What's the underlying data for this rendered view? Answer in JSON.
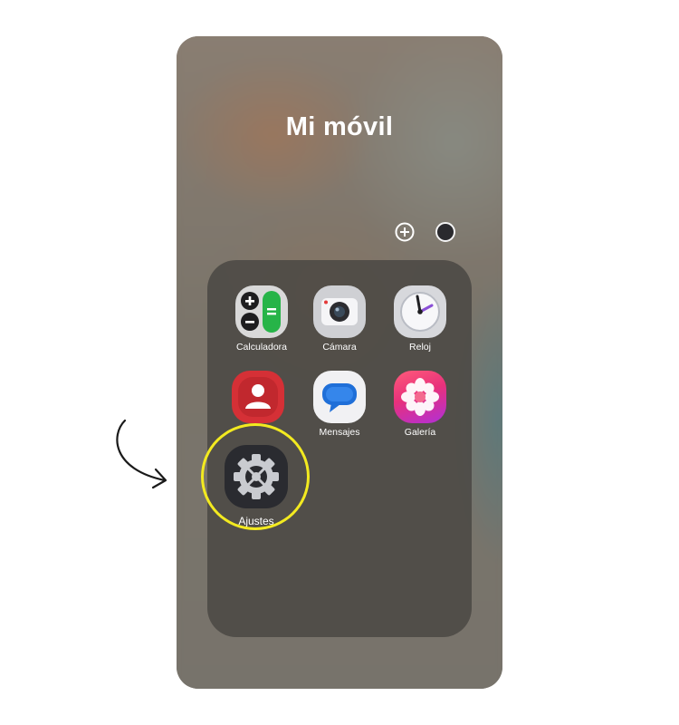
{
  "folder": {
    "title": "Mi móvil",
    "actions": {
      "add": "plus-icon",
      "color": "color-dot"
    }
  },
  "apps": [
    {
      "label": "Calculadora",
      "icon": "calculator-icon"
    },
    {
      "label": "Cámara",
      "icon": "camera-icon"
    },
    {
      "label": "Reloj",
      "icon": "clock-icon"
    },
    {
      "label": "",
      "icon": "contacts-icon"
    },
    {
      "label": "Mensajes",
      "icon": "messages-icon"
    },
    {
      "label": "Galería",
      "icon": "gallery-icon"
    },
    {
      "label": "Ajustes",
      "icon": "settings-icon"
    }
  ],
  "annotation": {
    "highlight_color": "#f3ea20",
    "arrow": "curved-arrow-icon"
  },
  "colors": {
    "title": "#ffffff",
    "folder_bg": "#48463f",
    "contacts": "#d53036",
    "settings": "#2a2b30"
  }
}
